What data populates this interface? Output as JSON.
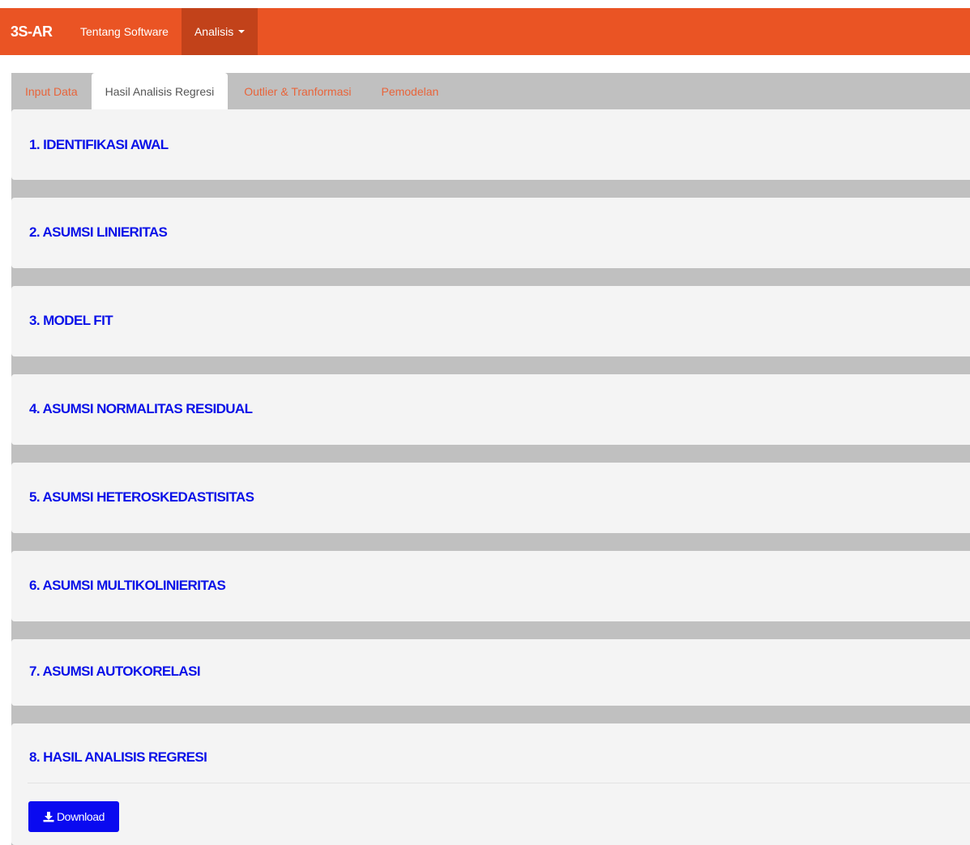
{
  "navbar": {
    "brand": "3S-AR",
    "about": "Tentang Software",
    "analysis": "Analisis",
    "color": "#ea5424"
  },
  "tabs": [
    {
      "label": "Input Data",
      "active": false
    },
    {
      "label": "Hasil Analisis Regresi",
      "active": true
    },
    {
      "label": "Outlier & Tranformasi",
      "active": false
    },
    {
      "label": "Pemodelan",
      "active": false
    }
  ],
  "sections": [
    {
      "title": "1. IDENTIFIKASI AWAL"
    },
    {
      "title": "2. ASUMSI LINIERITAS"
    },
    {
      "title": "3. MODEL FIT"
    },
    {
      "title": "4. ASUMSI NORMALITAS RESIDUAL"
    },
    {
      "title": "5. ASUMSI HETEROSKEDASTISITAS"
    },
    {
      "title": "6. ASUMSI MULTIKOLINIERITAS"
    },
    {
      "title": "7. ASUMSI AUTOKORELASI"
    },
    {
      "title": "8. HASIL ANALISIS REGRESI"
    }
  ],
  "download": {
    "label": "Download",
    "icon": "download-icon",
    "color": "#0a0af0"
  },
  "colors": {
    "section_title": "#0a11e8",
    "tab_inactive": "#e8643a",
    "background_band": "#c0c0c0"
  }
}
